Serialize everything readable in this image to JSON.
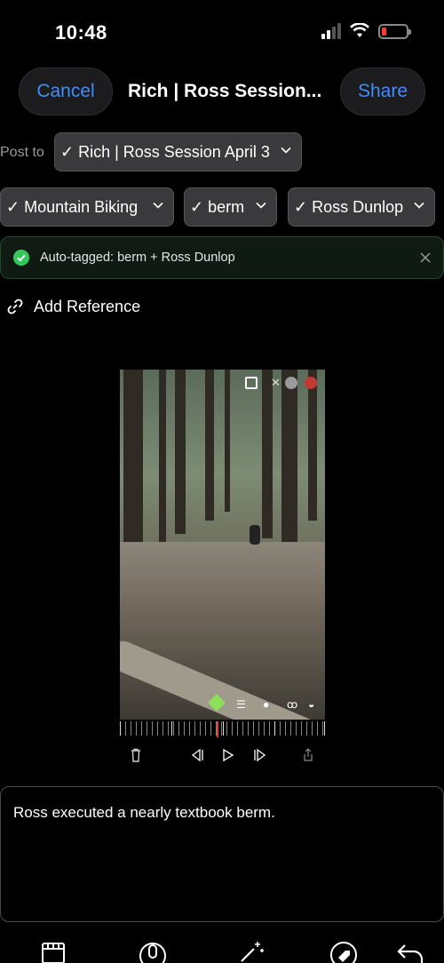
{
  "status_bar": {
    "time": "10:48",
    "battery_color": "#ff3b30"
  },
  "header": {
    "cancel_label": "Cancel",
    "title": "Rich | Ross Session...",
    "share_label": "Share",
    "accent_color": "#3d8ef7"
  },
  "post_to": {
    "label": "Post to",
    "selected": "✓ Rich | Ross Session April 3"
  },
  "tags": [
    {
      "label": "✓ Mountain Biking"
    },
    {
      "label": "✓ berm"
    },
    {
      "label": "✓ Ross Dunlop"
    }
  ],
  "banner": {
    "text": "Auto-tagged: berm + Ross Dunlop",
    "status_color": "#34c759"
  },
  "add_reference": {
    "label": "Add Reference",
    "icon": "link-icon"
  },
  "video": {
    "top_icons": [
      "picture-in-picture-icon",
      "mute-icon",
      "pause-icon",
      "record-icon"
    ],
    "bottom_icons": [
      "tag-icon",
      "sliders-icon",
      "timer-icon",
      "bike-icon",
      "speed-icon"
    ]
  },
  "playback_controls": [
    "trash-icon",
    "step-back-icon",
    "play-icon",
    "step-forward-icon",
    "share-icon"
  ],
  "caption": {
    "text": "Ross executed a nearly textbook berm."
  },
  "toolbar": [
    "film-icon",
    "mic-icon",
    "magic-wand-icon",
    "tag-icon",
    "undo-icon"
  ]
}
